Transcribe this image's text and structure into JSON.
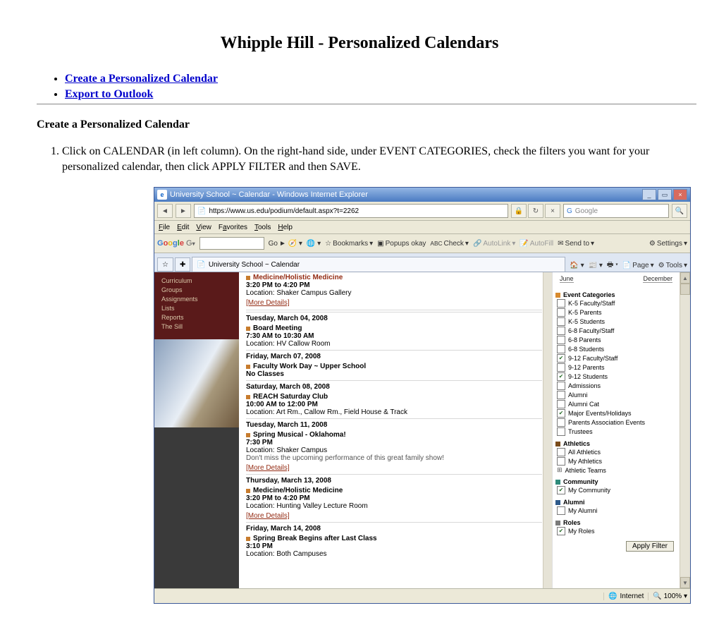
{
  "doc": {
    "title": "Whipple Hill - Personalized Calendars",
    "toc": {
      "create": "Create a Personalized Calendar",
      "export": "Export to Outlook"
    },
    "section1": {
      "heading": "Create a Personalized Calendar",
      "step1": "Click on CALENDAR (in left column). On the right-hand side, under EVENT CATEGORIES, check the filters you want for your personalized calendar, then click APPLY FILTER and then SAVE."
    }
  },
  "ie": {
    "title": "University School ~ Calendar - Windows Internet Explorer",
    "url": "https://www.us.edu/podium/default.aspx?t=2262",
    "search_placeholder": "Google",
    "menus": {
      "file": "File",
      "edit": "Edit",
      "view": "View",
      "fav": "Favorites",
      "tools": "Tools",
      "help": "Help"
    },
    "gt": {
      "logo": "Google",
      "go": "Go",
      "bookmarks": "Bookmarks",
      "popups": "Popups okay",
      "check": "Check",
      "autolink": "AutoLink",
      "autofill": "AutoFill",
      "sendto": "Send to",
      "settings": "Settings"
    },
    "tab": "University School ~ Calendar",
    "tabtools": {
      "home": "",
      "feed": "",
      "print": "",
      "page": "Page",
      "tools": "Tools"
    },
    "status": {
      "internet": "Internet",
      "zoom": "100%"
    }
  },
  "sidebar": {
    "items": [
      "Curriculum",
      "Groups",
      "Assignments",
      "Lists",
      "Reports",
      "The Sill"
    ]
  },
  "events": {
    "first": {
      "title": "Medicine/Holistic Medicine",
      "time": "3:20 PM to 4:20 PM",
      "loc": "Location: Shaker Campus Gallery",
      "more": "[More Details]"
    },
    "days": [
      {
        "date": "Tuesday, March 04, 2008",
        "items": [
          {
            "title": "Board Meeting",
            "time": "7:30 AM to 10:30 AM",
            "loc": "Location: HV Callow Room"
          }
        ]
      },
      {
        "date": "Friday, March 07, 2008",
        "items": [
          {
            "title": "Faculty Work Day ~ Upper School",
            "time": "No Classes",
            "loc": ""
          }
        ]
      },
      {
        "date": "Saturday, March 08, 2008",
        "items": [
          {
            "title": "REACH Saturday Club",
            "time": "10:00 AM to 12:00 PM",
            "loc": "Location: Art Rm., Callow Rm., Field House & Track"
          }
        ]
      },
      {
        "date": "Tuesday, March 11, 2008",
        "items": [
          {
            "title": "Spring Musical - Oklahoma!",
            "time": "7:30 PM",
            "loc": "Location: Shaker Campus",
            "desc": "Don't miss the upcoming performance of this great family show!",
            "more": "[More Details]"
          }
        ]
      },
      {
        "date": "Thursday, March 13, 2008",
        "items": [
          {
            "title": "Medicine/Holistic Medicine",
            "time": "3:20 PM to 4:20 PM",
            "loc": "Location: Hunting Valley Lecture Room",
            "more": "[More Details]"
          }
        ]
      },
      {
        "date": "Friday, March 14, 2008",
        "items": [
          {
            "title": "Spring Break Begins after Last Class",
            "time": "3:10 PM",
            "loc": "Location: Both Campuses"
          }
        ]
      }
    ]
  },
  "rightpanel": {
    "months": {
      "left": "June",
      "right": "December"
    },
    "groups": [
      {
        "name": "Event Categories",
        "color": "orange",
        "items": [
          {
            "label": "K-5 Faculty/Staff",
            "checked": false
          },
          {
            "label": "K-5 Parents",
            "checked": false
          },
          {
            "label": "K-5 Students",
            "checked": false
          },
          {
            "label": "6-8 Faculty/Staff",
            "checked": false
          },
          {
            "label": "6-8 Parents",
            "checked": false
          },
          {
            "label": "6-8 Students",
            "checked": false
          },
          {
            "label": "9-12 Faculty/Staff",
            "checked": true
          },
          {
            "label": "9-12 Parents",
            "checked": false
          },
          {
            "label": "9-12 Students",
            "checked": true
          },
          {
            "label": "Admissions",
            "checked": false
          },
          {
            "label": "Alumni",
            "checked": false
          },
          {
            "label": "Alumni Cat",
            "checked": false
          },
          {
            "label": "Major Events/Holidays",
            "checked": true
          },
          {
            "label": "Parents Association Events",
            "checked": false
          },
          {
            "label": "Trustees",
            "checked": false
          }
        ]
      },
      {
        "name": "Athletics",
        "color": "brown",
        "items": [
          {
            "label": "All Athletics",
            "checked": false
          },
          {
            "label": "My Athletics",
            "checked": false
          },
          {
            "label": "Athletic Teams",
            "checked": false,
            "icon": "plus"
          }
        ]
      },
      {
        "name": "Community",
        "color": "teal",
        "items": [
          {
            "label": "My Community",
            "checked": true
          }
        ]
      },
      {
        "name": "Alumni",
        "color": "blue",
        "items": [
          {
            "label": "My Alumni",
            "checked": false
          }
        ]
      },
      {
        "name": "Roles",
        "color": "grey",
        "items": [
          {
            "label": "My Roles",
            "checked": true
          }
        ]
      }
    ],
    "apply": "Apply Filter"
  }
}
